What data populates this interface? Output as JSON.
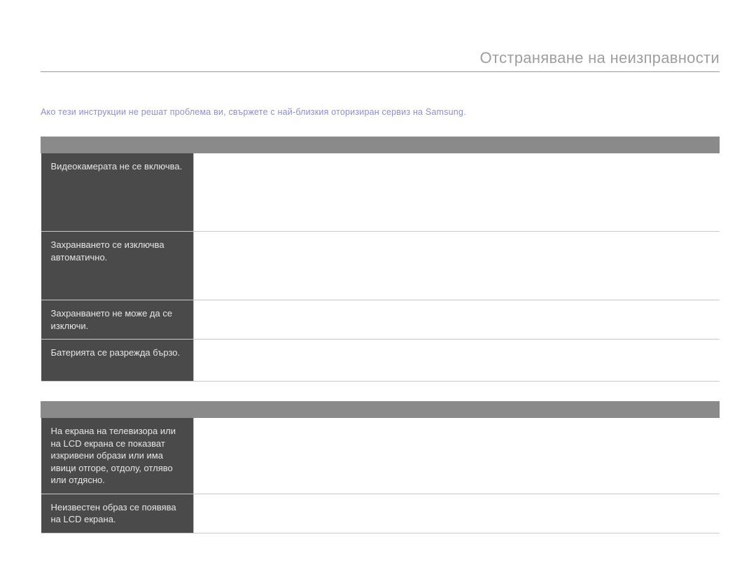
{
  "header": {
    "title": "Отстраняване на неизправности"
  },
  "intro": {
    "small_top": " ",
    "note": "Ако тези инструкции не решат проблема ви, свържете с най-близкия оторизиран сервиз на Samsung.",
    "section1": " "
  },
  "table1": {
    "head_symptom": " ",
    "head_solution": " ",
    "rows": [
      {
        "symptom": "Видеокамерата не се включва.",
        "solution": ""
      },
      {
        "symptom": "Захранването се изключва автоматично.",
        "solution": ""
      },
      {
        "symptom": "Захранването не може да се изключи.",
        "solution": ""
      },
      {
        "symptom": "Батерията се разрежда бързо.",
        "solution": ""
      }
    ]
  },
  "section2_label": " ",
  "table2": {
    "head_symptom": " ",
    "head_solution": " ",
    "rows": [
      {
        "symptom": "На екрана на телевизора или на LCD екрана се показват изкривени образи или има ивици отгоре, отдолу, отляво или отдясно.",
        "solution": ""
      },
      {
        "symptom": "Неизвестен образ се появява на LCD екрана.",
        "solution": ""
      }
    ]
  },
  "page_number": " "
}
